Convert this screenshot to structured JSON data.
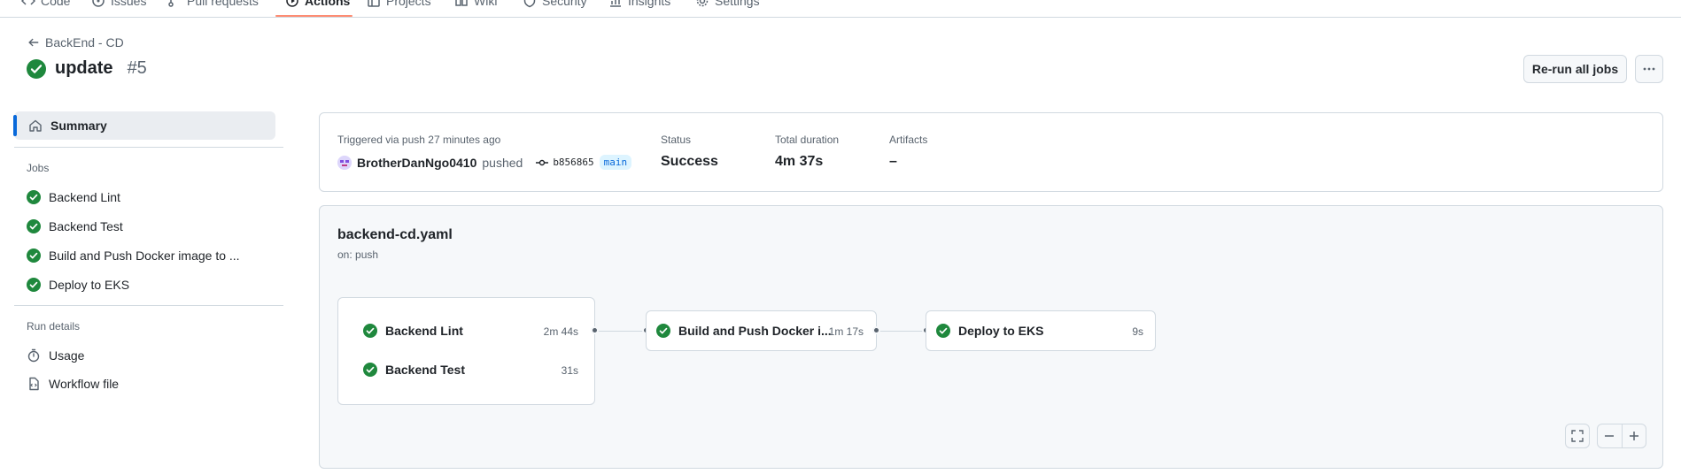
{
  "colors": {
    "success": "#1f883d",
    "accent": "#0969da",
    "nav_underline": "#fd8c73",
    "border": "#d1d9e0"
  },
  "nav": {
    "tabs": [
      {
        "label": "Code",
        "icon": "code-icon"
      },
      {
        "label": "Issues",
        "icon": "issue-icon"
      },
      {
        "label": "Pull requests",
        "icon": "pull-request-icon"
      },
      {
        "label": "Actions",
        "icon": "play-icon",
        "active": true
      },
      {
        "label": "Projects",
        "icon": "table-icon"
      },
      {
        "label": "Wiki",
        "icon": "book-icon"
      },
      {
        "label": "Security",
        "icon": "shield-icon"
      },
      {
        "label": "Insights",
        "icon": "graph-icon"
      },
      {
        "label": "Settings",
        "icon": "gear-icon"
      }
    ]
  },
  "header": {
    "back_label": "BackEnd - CD",
    "run_title": "update",
    "run_number": "#5",
    "rerun_label": "Re-run all jobs"
  },
  "sidebar": {
    "summary_label": "Summary",
    "jobs_heading": "Jobs",
    "jobs": [
      {
        "label": "Backend Lint"
      },
      {
        "label": "Backend Test"
      },
      {
        "label": "Build and Push Docker image to ..."
      },
      {
        "label": "Deploy to EKS"
      }
    ],
    "run_details_heading": "Run details",
    "details": [
      {
        "label": "Usage",
        "icon": "stopwatch-icon"
      },
      {
        "label": "Workflow file",
        "icon": "file-code-icon"
      }
    ]
  },
  "summary": {
    "trigger_text": "Triggered via push 27 minutes ago",
    "author": "BrotherDanNgo0410",
    "action": "pushed",
    "commit_sha": "b856865",
    "branch": "main",
    "status_label": "Status",
    "status_value": "Success",
    "duration_label": "Total duration",
    "duration_value": "4m 37s",
    "artifacts_label": "Artifacts",
    "artifacts_value": "–"
  },
  "workflow": {
    "file_name": "backend-cd.yaml",
    "trigger": "on: push",
    "jobs": [
      {
        "name": "Backend Lint",
        "duration": "2m 44s"
      },
      {
        "name": "Backend Test",
        "duration": "31s"
      },
      {
        "name": "Build and Push Docker i...",
        "duration": "1m 17s"
      },
      {
        "name": "Deploy to EKS",
        "duration": "9s"
      }
    ]
  }
}
